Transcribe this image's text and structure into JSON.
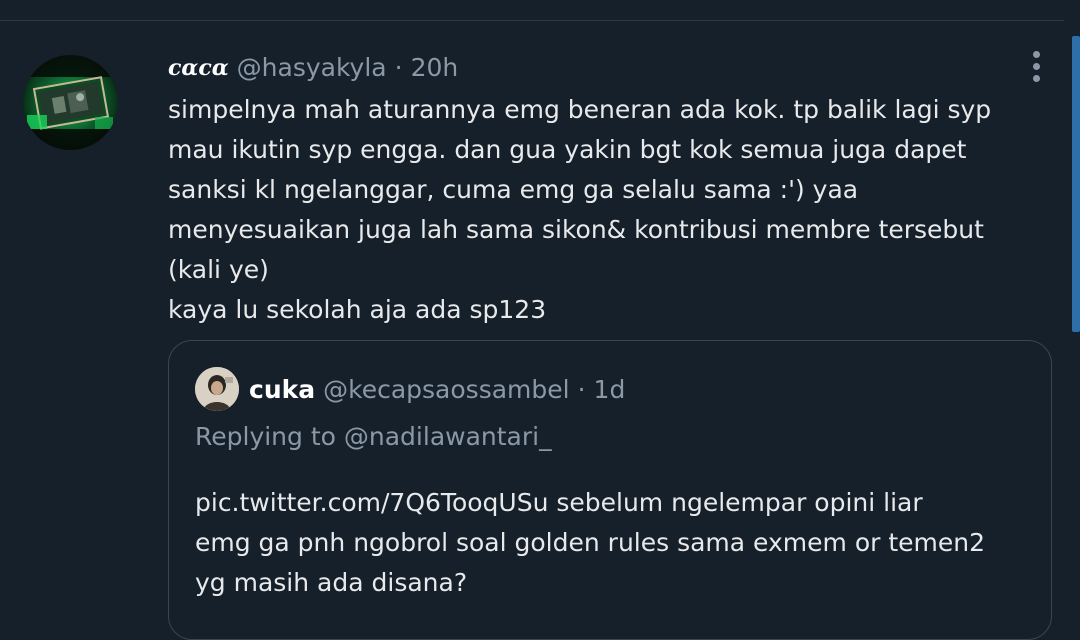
{
  "tweet": {
    "display_name": "cɑcɑ",
    "handle": "@hasyakyla",
    "separator": "·",
    "time": "20h",
    "body_lines": [
      "simpelnya mah aturannya emg beneran ada kok. tp balik lagi syp",
      "mau ikutin syp engga. dan gua yakin bgt kok semua juga dapet",
      "sanksi kl ngelanggar, cuma emg ga selalu sama :') yaa",
      "menyesuaikan juga lah sama sikon& kontribusi membre tersebut",
      "(kali ye)",
      "kaya lu sekolah aja ada sp123"
    ],
    "more_icon": "more-vertical-icon"
  },
  "quoted": {
    "display_name": "cuka",
    "handle": "@kecapsaossambel",
    "separator": "·",
    "time": "1d",
    "replying_prefix": "Replying to ",
    "replying_handle": "@nadilawantari_",
    "body_lines": [
      "pic.twitter.com/7Q6TooqUSu sebelum ngelempar opini liar",
      "emg ga pnh ngobrol soal golden rules sama exmem or temen2",
      "yg masih ada disana?"
    ]
  },
  "colors": {
    "background": "#16202b",
    "text": "#e7e9ea",
    "muted": "#8b98a5",
    "accent_green": "#19d15a",
    "scrollbar": "#2d6fa8"
  }
}
